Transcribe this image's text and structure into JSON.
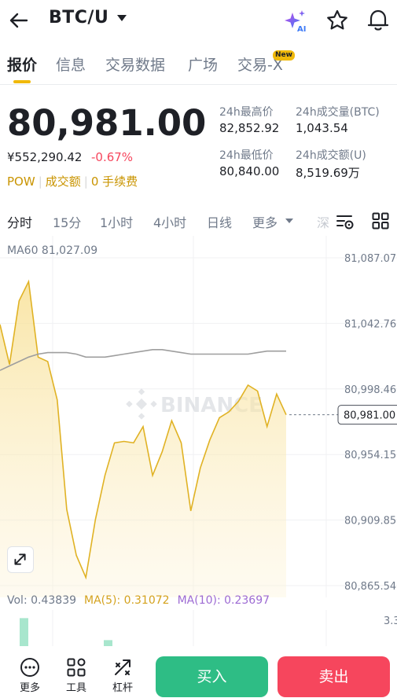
{
  "header": {
    "pair": "BTC/U"
  },
  "tabs": [
    {
      "label": "报价"
    },
    {
      "label": "信息"
    },
    {
      "label": "交易数据"
    },
    {
      "label": "广场"
    },
    {
      "label": "交易-X"
    }
  ],
  "new_badge": "New",
  "price": {
    "last": "80,981.00",
    "cny": "¥552,290.42",
    "change": "-0.67%",
    "tags": [
      "POW",
      "成交额",
      "0 手续费"
    ]
  },
  "stats": {
    "high_label": "24h最高价",
    "high_value": "82,852.92",
    "vol_btc_label": "24h成交量(BTC)",
    "vol_btc_value": "1,043.54",
    "low_label": "24h最低价",
    "low_value": "80,840.00",
    "vol_u_label": "24h成交额(U)",
    "vol_u_value": "8,519.69万"
  },
  "intervals": [
    {
      "label": "分时"
    },
    {
      "label": "15分"
    },
    {
      "label": "1小时"
    },
    {
      "label": "4小时"
    },
    {
      "label": "日线"
    },
    {
      "label": "更多"
    }
  ],
  "depth_label": "深",
  "ma60_label": "MA60 81,027.09",
  "watermark": "BINANCE",
  "chart_data": {
    "type": "area",
    "y_ticks": [
      "81,087.07",
      "81,042.76",
      "80,998.46",
      "80,954.15",
      "80,909.85",
      "80,865.54"
    ],
    "ylim": [
      80865.54,
      81087.07
    ],
    "current_price_label": "80,981.00",
    "current_price": 80981.0,
    "series": [
      {
        "values": [
          81042,
          81015,
          81058,
          81071,
          81020,
          81017,
          80991,
          80917,
          80886,
          80871,
          80910,
          80940,
          80962,
          80963,
          80962,
          80973,
          80940,
          80956,
          80977,
          80962,
          80916,
          80945,
          80964,
          80979,
          80983,
          80990,
          81001,
          80997,
          80973,
          80995,
          80981
        ]
      },
      {
        "values": [
          81011,
          81014,
          81017,
          81020,
          81022,
          81023,
          81023,
          81023,
          81022,
          81020,
          81020,
          81020,
          81021,
          81022,
          81023,
          81024,
          81025,
          81025,
          81024,
          81023,
          81022,
          81022,
          81022,
          81022,
          81022,
          81022,
          81022,
          81023,
          81024,
          81024,
          81024
        ]
      }
    ]
  },
  "volume": {
    "vol_label": "Vol: 0.43839",
    "ma5_label": "MA(5): 0.31072",
    "ma10_label": "MA(10): 0.23697",
    "axis_label": "3.3",
    "bars": [
      {
        "x": 31,
        "value": 2.8,
        "color": "#a8e6cd"
      },
      {
        "x": 138,
        "value": 0.6,
        "color": "#a8e6cd"
      }
    ],
    "max": 3.3
  },
  "bottom_bar": {
    "more": "更多",
    "tools": "工具",
    "leverage": "杠杆",
    "buy": "买入",
    "sell": "卖出"
  },
  "colors": {
    "accent": "#f0b90b",
    "up": "#2ebd85",
    "down": "#f6465d",
    "line": "#e0b224",
    "ma": "#9e9e9e"
  }
}
